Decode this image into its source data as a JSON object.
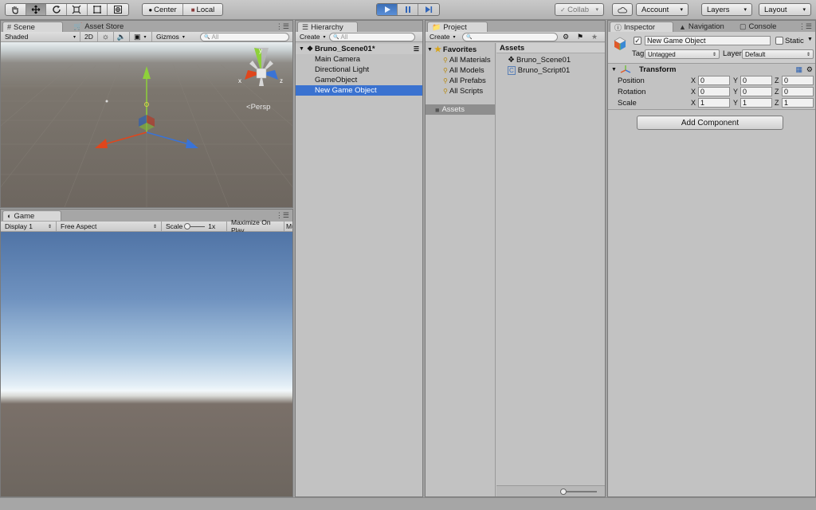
{
  "toolbar": {
    "pivot_label": "Center",
    "space_label": "Local",
    "collab_label": "Collab",
    "account_label": "Account",
    "layers_label": "Layers",
    "layout_label": "Layout"
  },
  "scene": {
    "tab_label": "Scene",
    "asset_store_tab": "Asset Store",
    "shading_mode": "Shaded",
    "mode_2d": "2D",
    "gizmos_label": "Gizmos",
    "search_placeholder": "All",
    "persp_label": "Persp",
    "axis_x": "x",
    "axis_y": "y",
    "axis_z": "z"
  },
  "game": {
    "tab_label": "Game",
    "display": "Display 1",
    "aspect": "Free Aspect",
    "scale_label": "Scale",
    "scale_value": "1x",
    "maximize_label": "Maximize On Play",
    "mute_label": "Mu"
  },
  "hierarchy": {
    "tab_label": "Hierarchy",
    "create_label": "Create",
    "search_placeholder": "All",
    "scene_name": "Bruno_Scene01*",
    "items": [
      "Main Camera",
      "Directional Light",
      "GameObject",
      "New Game Object"
    ],
    "selected_index": 3
  },
  "project": {
    "tab_label": "Project",
    "create_label": "Create",
    "favorites_label": "Favorites",
    "favorites": [
      "All Materials",
      "All Models",
      "All Prefabs",
      "All Scripts"
    ],
    "tree_assets_label": "Assets",
    "assets_header": "Assets",
    "assets": [
      {
        "name": "Bruno_Scene01",
        "icon": "unity-scene-icon"
      },
      {
        "name": "Bruno_Script01",
        "icon": "csharp-script-icon"
      }
    ]
  },
  "inspector": {
    "tab_label": "Inspector",
    "navigation_tab": "Navigation",
    "console_tab": "Console",
    "object_name": "New Game Object",
    "active_checked": true,
    "static_label": "Static",
    "tag_label": "Tag",
    "tag_value": "Untagged",
    "layer_label": "Layer",
    "layer_value": "Default",
    "transform_label": "Transform",
    "position_label": "Position",
    "rotation_label": "Rotation",
    "scale_label": "Scale",
    "position": {
      "x": "0",
      "y": "0",
      "z": "0"
    },
    "rotation": {
      "x": "0",
      "y": "0",
      "z": "0"
    },
    "scale": {
      "x": "1",
      "y": "1",
      "z": "1"
    },
    "axis_x": "X",
    "axis_y": "Y",
    "axis_z": "Z",
    "add_component_label": "Add Component"
  },
  "colors": {
    "selection": "#3a72d0",
    "play_active": "#4a7fc7",
    "gizmo_x": "#e0461c",
    "gizmo_y": "#8ed13a",
    "gizmo_z": "#3a73d6"
  }
}
